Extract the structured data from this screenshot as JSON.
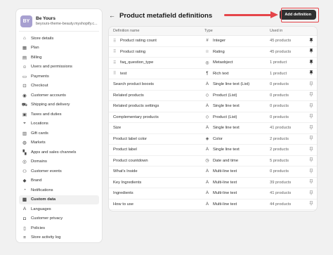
{
  "store": {
    "initials": "BY",
    "name": "Be Yours",
    "domain": "beyours-theme-beauty.myshopify.c..."
  },
  "sidebar": {
    "items": [
      {
        "label": "Store details",
        "icon": "store-icon"
      },
      {
        "label": "Plan",
        "icon": "plan-icon"
      },
      {
        "label": "Billing",
        "icon": "billing-icon"
      },
      {
        "label": "Users and permissions",
        "icon": "users-icon"
      },
      {
        "label": "Payments",
        "icon": "payments-icon"
      },
      {
        "label": "Checkout",
        "icon": "checkout-icon"
      },
      {
        "label": "Customer accounts",
        "icon": "customer-accounts-icon"
      },
      {
        "label": "Shipping and delivery",
        "icon": "shipping-icon"
      },
      {
        "label": "Taxes and duties",
        "icon": "taxes-icon"
      },
      {
        "label": "Locations",
        "icon": "location-icon"
      },
      {
        "label": "Gift cards",
        "icon": "gift-card-icon"
      },
      {
        "label": "Markets",
        "icon": "globe-icon"
      },
      {
        "label": "Apps and sales channels",
        "icon": "apps-icon"
      },
      {
        "label": "Domains",
        "icon": "domains-icon"
      },
      {
        "label": "Customer events",
        "icon": "events-icon"
      },
      {
        "label": "Brand",
        "icon": "brand-icon"
      },
      {
        "label": "Notifications",
        "icon": "bell-icon"
      },
      {
        "label": "Custom data",
        "icon": "custom-data-icon",
        "active": true
      },
      {
        "label": "Languages",
        "icon": "languages-icon"
      },
      {
        "label": "Customer privacy",
        "icon": "lock-icon"
      },
      {
        "label": "Policies",
        "icon": "policies-icon"
      },
      {
        "label": "Store activity log",
        "icon": "activity-log-icon"
      }
    ]
  },
  "header": {
    "title": "Product metafield definitions",
    "add_button": "Add definition"
  },
  "table": {
    "columns": {
      "name": "Definition name",
      "type": "Type",
      "used": "Used in"
    },
    "rows": [
      {
        "name": "Product rating count",
        "type": "Integer",
        "type_icon": "#",
        "used": "45 products",
        "pinned": true
      },
      {
        "name": "Product rating",
        "type": "Rating",
        "type_icon": "☆",
        "used": "45 products",
        "pinned": true
      },
      {
        "name": "faq_question_type",
        "type": "Metaobject",
        "type_icon": "◎",
        "used": "1 product",
        "pinned": true
      },
      {
        "name": "test",
        "type": "Rich text",
        "type_icon": "¶",
        "used": "1 product",
        "pinned": true
      },
      {
        "name": "Search product boosts",
        "type": "Single line text (List)",
        "type_icon": "A",
        "used": "0 products",
        "pinned": false
      },
      {
        "name": "Related products",
        "type": "Product (List)",
        "type_icon": "◇",
        "used": "0 products",
        "pinned": false
      },
      {
        "name": "Related products settings",
        "type": "Single line text",
        "type_icon": "A",
        "used": "0 products",
        "pinned": false
      },
      {
        "name": "Complementary products",
        "type": "Product (List)",
        "type_icon": "◇",
        "used": "0 products",
        "pinned": false
      },
      {
        "name": "Size",
        "type": "Single line text",
        "type_icon": "A",
        "used": "41 products",
        "pinned": false
      },
      {
        "name": "Product label color",
        "type": "Color",
        "type_icon": "◈",
        "used": "2 products",
        "pinned": false
      },
      {
        "name": "Product label",
        "type": "Single line text",
        "type_icon": "A",
        "used": "2 products",
        "pinned": false
      },
      {
        "name": "Product countdown",
        "type": "Date and time",
        "type_icon": "◷",
        "used": "5 products",
        "pinned": false
      },
      {
        "name": "What's Inside",
        "type": "Multi-line text",
        "type_icon": "A",
        "used": "0 products",
        "pinned": false
      },
      {
        "name": "Key Ingredients",
        "type": "Multi-line text",
        "type_icon": "A",
        "used": "39 products",
        "pinned": false
      },
      {
        "name": "Ingredients",
        "type": "Multi-line text",
        "type_icon": "A",
        "used": "41 products",
        "pinned": false
      },
      {
        "name": "How to use",
        "type": "Multi-line text",
        "type_icon": "A",
        "used": "44 products",
        "pinned": false
      }
    ]
  },
  "colors": {
    "annotation": "#e5454a",
    "primary_button": "#303030",
    "avatar": "#a7a0d0"
  }
}
